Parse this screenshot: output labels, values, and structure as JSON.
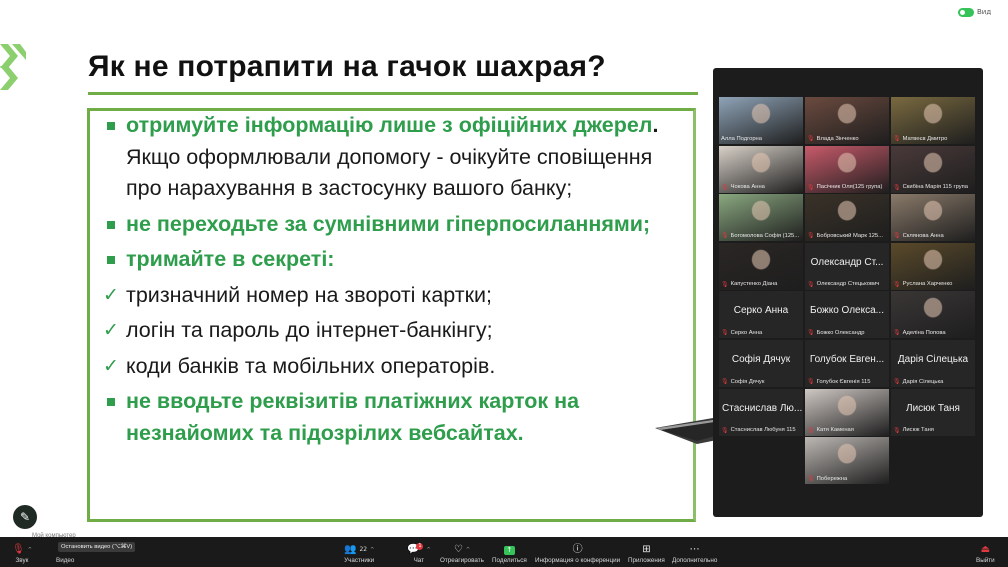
{
  "indicator": {
    "text": "Вид"
  },
  "slide": {
    "title": "Як не потрапити на гачок шахрая?",
    "bullets": [
      {
        "marker": "square",
        "parts": [
          {
            "style": "g",
            "text": "отримуйте інформацію лише з офіційних джерел"
          },
          {
            "style": "k",
            "text": ". "
          },
          {
            "style": "n",
            "text": "Якщо оформлювали допомогу - очікуйте сповіщення про нарахування в застосунку вашого банку;"
          }
        ]
      },
      {
        "marker": "square",
        "parts": [
          {
            "style": "g",
            "text": "не переходьте за сумнівними гіперпосиланнями;"
          }
        ]
      },
      {
        "marker": "square",
        "parts": [
          {
            "style": "g",
            "text": "тримайте в секреті:"
          }
        ]
      },
      {
        "marker": "check",
        "parts": [
          {
            "style": "n",
            "text": "тризначний номер на звороті картки;"
          }
        ]
      },
      {
        "marker": "check",
        "parts": [
          {
            "style": "n",
            "text": "логін та пароль до інтернет-банкінгу;"
          }
        ]
      },
      {
        "marker": "check",
        "parts": [
          {
            "style": "n",
            "text": "коди банків та мобільних операторів."
          }
        ]
      },
      {
        "marker": "square",
        "parts": [
          {
            "style": "g",
            "text": "не вводьте реквізитів платіжних карток на незнайомих та підозрілих вебсайтах."
          }
        ]
      }
    ],
    "footer": "Мой компьютер"
  },
  "participants": [
    {
      "name": "Алла Подгорна",
      "video": true,
      "active": true,
      "tone": "#8fa4b8"
    },
    {
      "name": "Влада Зінченко",
      "video": true,
      "tone": "#6b4a3f"
    },
    {
      "name": "Матвеєв Дмитро",
      "video": true,
      "tone": "#7a6a40"
    },
    {
      "name": "Чокова Анна",
      "video": true,
      "tone": "#d8d1c8"
    },
    {
      "name": "Пасічник Оля(125 група)",
      "video": true,
      "tone": "#c85a6a"
    },
    {
      "name": "Скибіна Марія 115 група",
      "video": true,
      "tone": "#4a3a3a"
    },
    {
      "name": "Богомолова Софія (125...",
      "video": true,
      "tone": "#8aa880"
    },
    {
      "name": "Бобровський Марк 125...",
      "video": true,
      "tone": "#3a3228"
    },
    {
      "name": "Склянова Анна",
      "video": true,
      "tone": "#8a7a6a"
    },
    {
      "name": "Капустенко Діана",
      "video": true,
      "tone": "#2a2624"
    },
    {
      "name": "Олександр Стецькович",
      "video": false,
      "big": "Олександр Ст..."
    },
    {
      "name": "Руслана Харченко",
      "video": true,
      "tone": "#5a4a2a"
    },
    {
      "name": "Серко Анна",
      "video": false,
      "big": "Серко Анна"
    },
    {
      "name": "Божко Олександр",
      "video": false,
      "big": "Божко Олекса..."
    },
    {
      "name": "Аделіна Попова",
      "video": true,
      "tone": "#3a3636"
    },
    {
      "name": "Софія Дячук",
      "video": false,
      "big": "Софія Дячук"
    },
    {
      "name": "Голубок Євгенія 115",
      "video": false,
      "big": "Голубок Евген..."
    },
    {
      "name": "Дарія Сілецька",
      "video": false,
      "big": "Дарія Сілецька"
    },
    {
      "name": "Стаснислав Любуня 115",
      "video": false,
      "big": "Стаснислав Лю..."
    },
    {
      "name": "Катя Каменая",
      "video": true,
      "tone": "#cfc8c4"
    },
    {
      "name": "Лисюк Таня",
      "video": false,
      "big": "Лисюк Таня"
    },
    {
      "name": "Побережна",
      "video": true,
      "tone": "#bdb8b4"
    }
  ],
  "toolbar": {
    "mic": "Звук",
    "video": "Видео",
    "stop_video": "Остановить видео (⌥⌘V)",
    "participants": "Участники",
    "participants_count": "22",
    "chat": "Чат",
    "chat_badge": "1",
    "react": "Отреагировать",
    "share": "Поделиться",
    "info": "Информация о конференции",
    "apps": "Приложения",
    "more": "Дополнительно",
    "exit": "Выйти"
  },
  "colors": {
    "accent": "#2e9d4c",
    "border": "#70ad47",
    "exit": "#e0393e"
  }
}
